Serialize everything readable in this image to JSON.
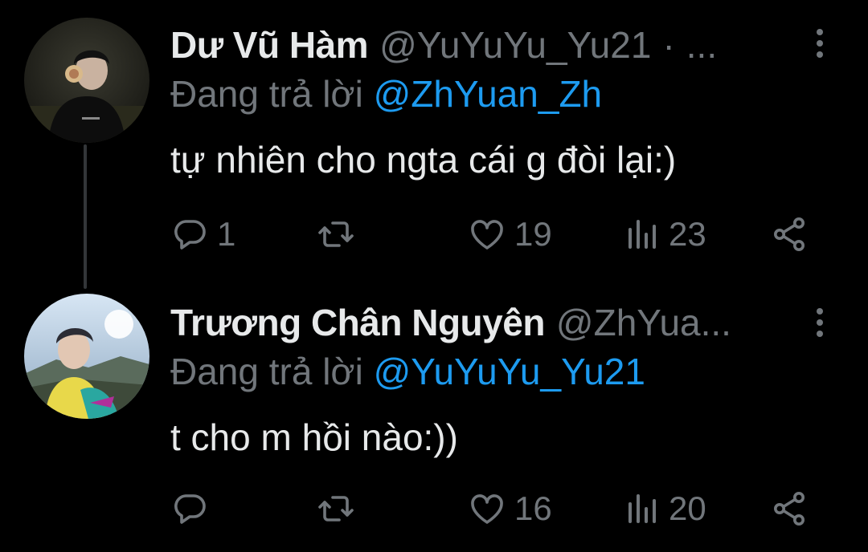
{
  "tweets": [
    {
      "author_name": "Dư Vũ Hàm",
      "author_handle": "@YuYuYu_Yu21",
      "separator": "·",
      "overflow": "...",
      "replying_prefix": "Đang trả lời",
      "replying_to": "@ZhYuan_Zh",
      "text": "tự nhiên cho ngta cái g đòi lại:)",
      "reply_count": "1",
      "retweet_count": "",
      "like_count": "19",
      "view_count": "23",
      "icons": [
        "reply-icon",
        "retweet-icon",
        "like-icon",
        "views-icon",
        "share-icon",
        "more-icon"
      ]
    },
    {
      "author_name": "Trương Chân Nguyên",
      "author_handle": "@ZhYua...",
      "replying_prefix": "Đang trả lời",
      "replying_to": "@YuYuYu_Yu21",
      "text": "t cho m hồi nào:))",
      "reply_count": "",
      "retweet_count": "",
      "like_count": "16",
      "view_count": "20",
      "icons": [
        "reply-icon",
        "retweet-icon",
        "like-icon",
        "views-icon",
        "share-icon",
        "more-icon"
      ]
    }
  ],
  "colors": {
    "background": "#000000",
    "text": "#e7e9ea",
    "muted": "#71767b",
    "link": "#1d9bf0",
    "thread_line": "#333639"
  }
}
